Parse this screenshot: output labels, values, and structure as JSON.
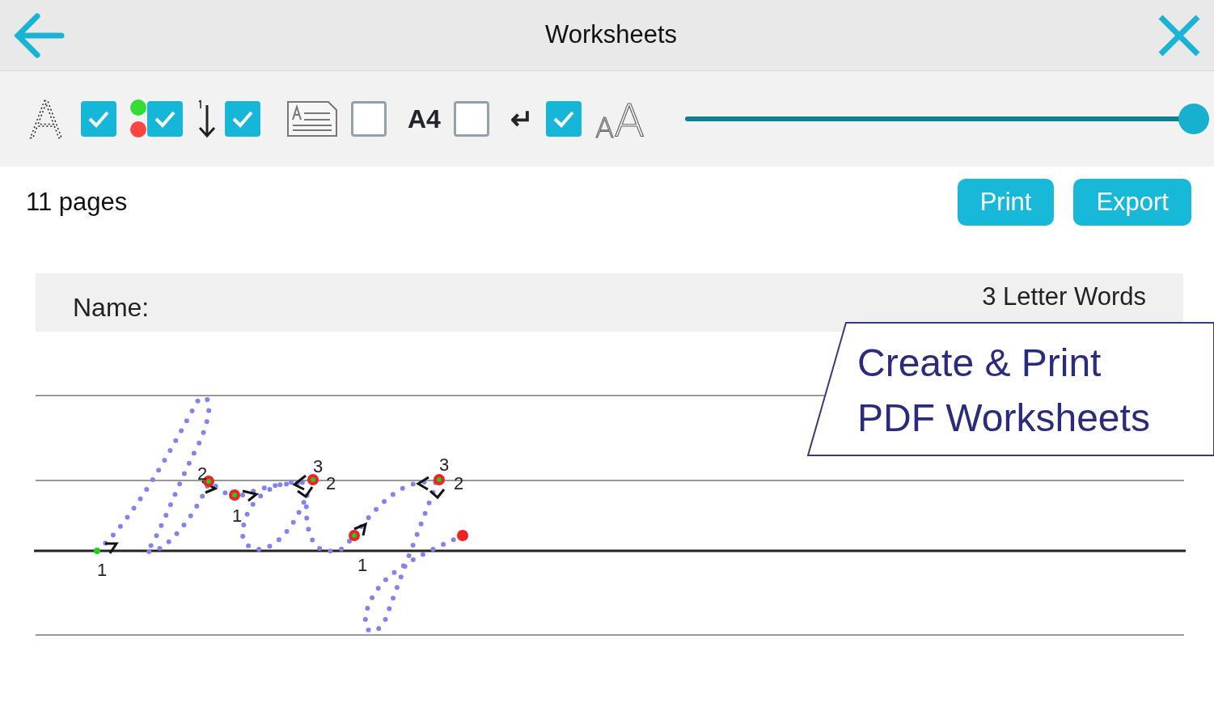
{
  "header": {
    "title": "Worksheets"
  },
  "toolbar": [
    {
      "kind": "dotted-letter",
      "glyph": "A"
    },
    {
      "kind": "checkbox",
      "checked": true
    },
    {
      "kind": "dots"
    },
    {
      "kind": "checkbox",
      "checked": true
    },
    {
      "kind": "order"
    },
    {
      "kind": "checkbox",
      "checked": true
    },
    {
      "kind": "document"
    },
    {
      "kind": "checkbox",
      "checked": false
    },
    {
      "kind": "label",
      "text": "A4"
    },
    {
      "kind": "checkbox",
      "checked": false
    },
    {
      "kind": "symbol",
      "text": "↵"
    },
    {
      "kind": "checkbox",
      "checked": true
    },
    {
      "kind": "size-letters",
      "glyphs": [
        "A",
        "A"
      ]
    },
    {
      "kind": "slider",
      "level": 1.0
    }
  ],
  "summary": {
    "pages": "11 pages",
    "buttons": [
      "Print",
      "Export"
    ]
  },
  "worksheet": {
    "name_label": "Name:",
    "title": "3 Letter Words",
    "stroke_numbers": [
      "1",
      "2",
      "1",
      "3",
      "2",
      "1",
      "3",
      "2"
    ]
  },
  "banner": {
    "lines": [
      "Create & Print",
      "PDF Worksheets"
    ]
  }
}
